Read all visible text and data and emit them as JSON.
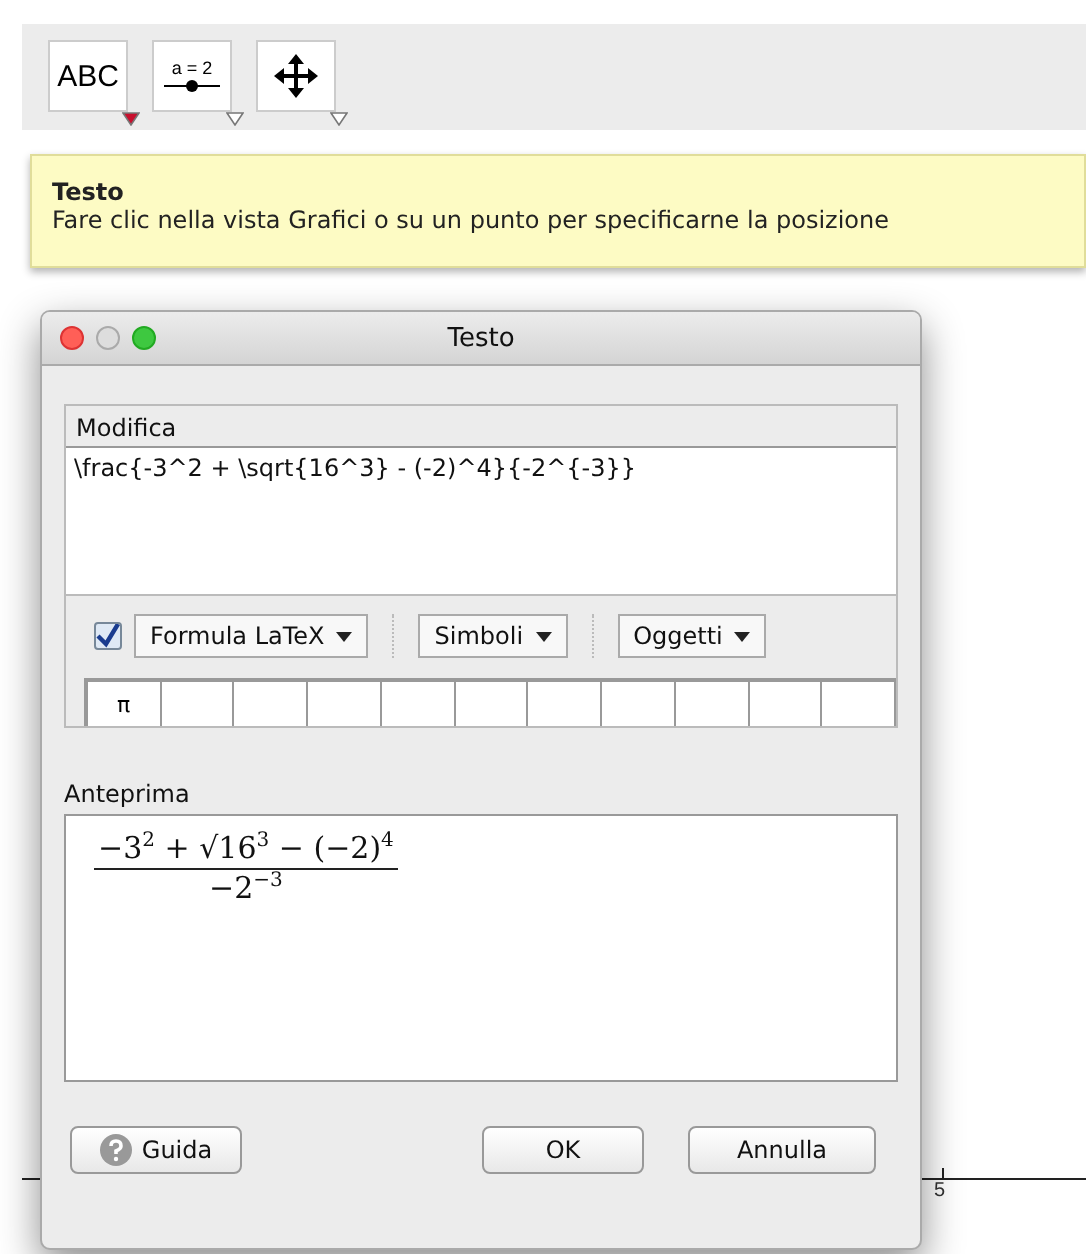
{
  "toolbar": {
    "tools": [
      {
        "kind": "text",
        "label": "ABC",
        "selected": true
      },
      {
        "kind": "slider",
        "label": "a = 2",
        "selected": false
      },
      {
        "kind": "move",
        "selected": false
      }
    ]
  },
  "tooltip": {
    "title": "Testo",
    "text": "Fare clic nella vista Grafici o su un punto per specificarne la posizione"
  },
  "graphics": {
    "axis_label": "5"
  },
  "dialog": {
    "title": "Testo",
    "edit_label": "Modifica",
    "input_value": "\\frac{-3^2 + \\sqrt{16^3} - (-2)^4}{-2^{-3}}",
    "latex_checked": true,
    "dropdowns": [
      "Formula LaTeX",
      "Simboli",
      "Oggetti"
    ],
    "symbols": [
      "π"
    ],
    "preview_label": "Anteprima",
    "preview": {
      "numerator": "−3$^{2}$ + √16$^{3}$ − (−2)$^{4}$",
      "denominator": "−2$^{−3}$"
    },
    "buttons": [
      {
        "kind": "help",
        "label": "Guida"
      },
      {
        "kind": "ok",
        "label": "OK"
      },
      {
        "kind": "cancel",
        "label": "Annulla"
      }
    ]
  }
}
